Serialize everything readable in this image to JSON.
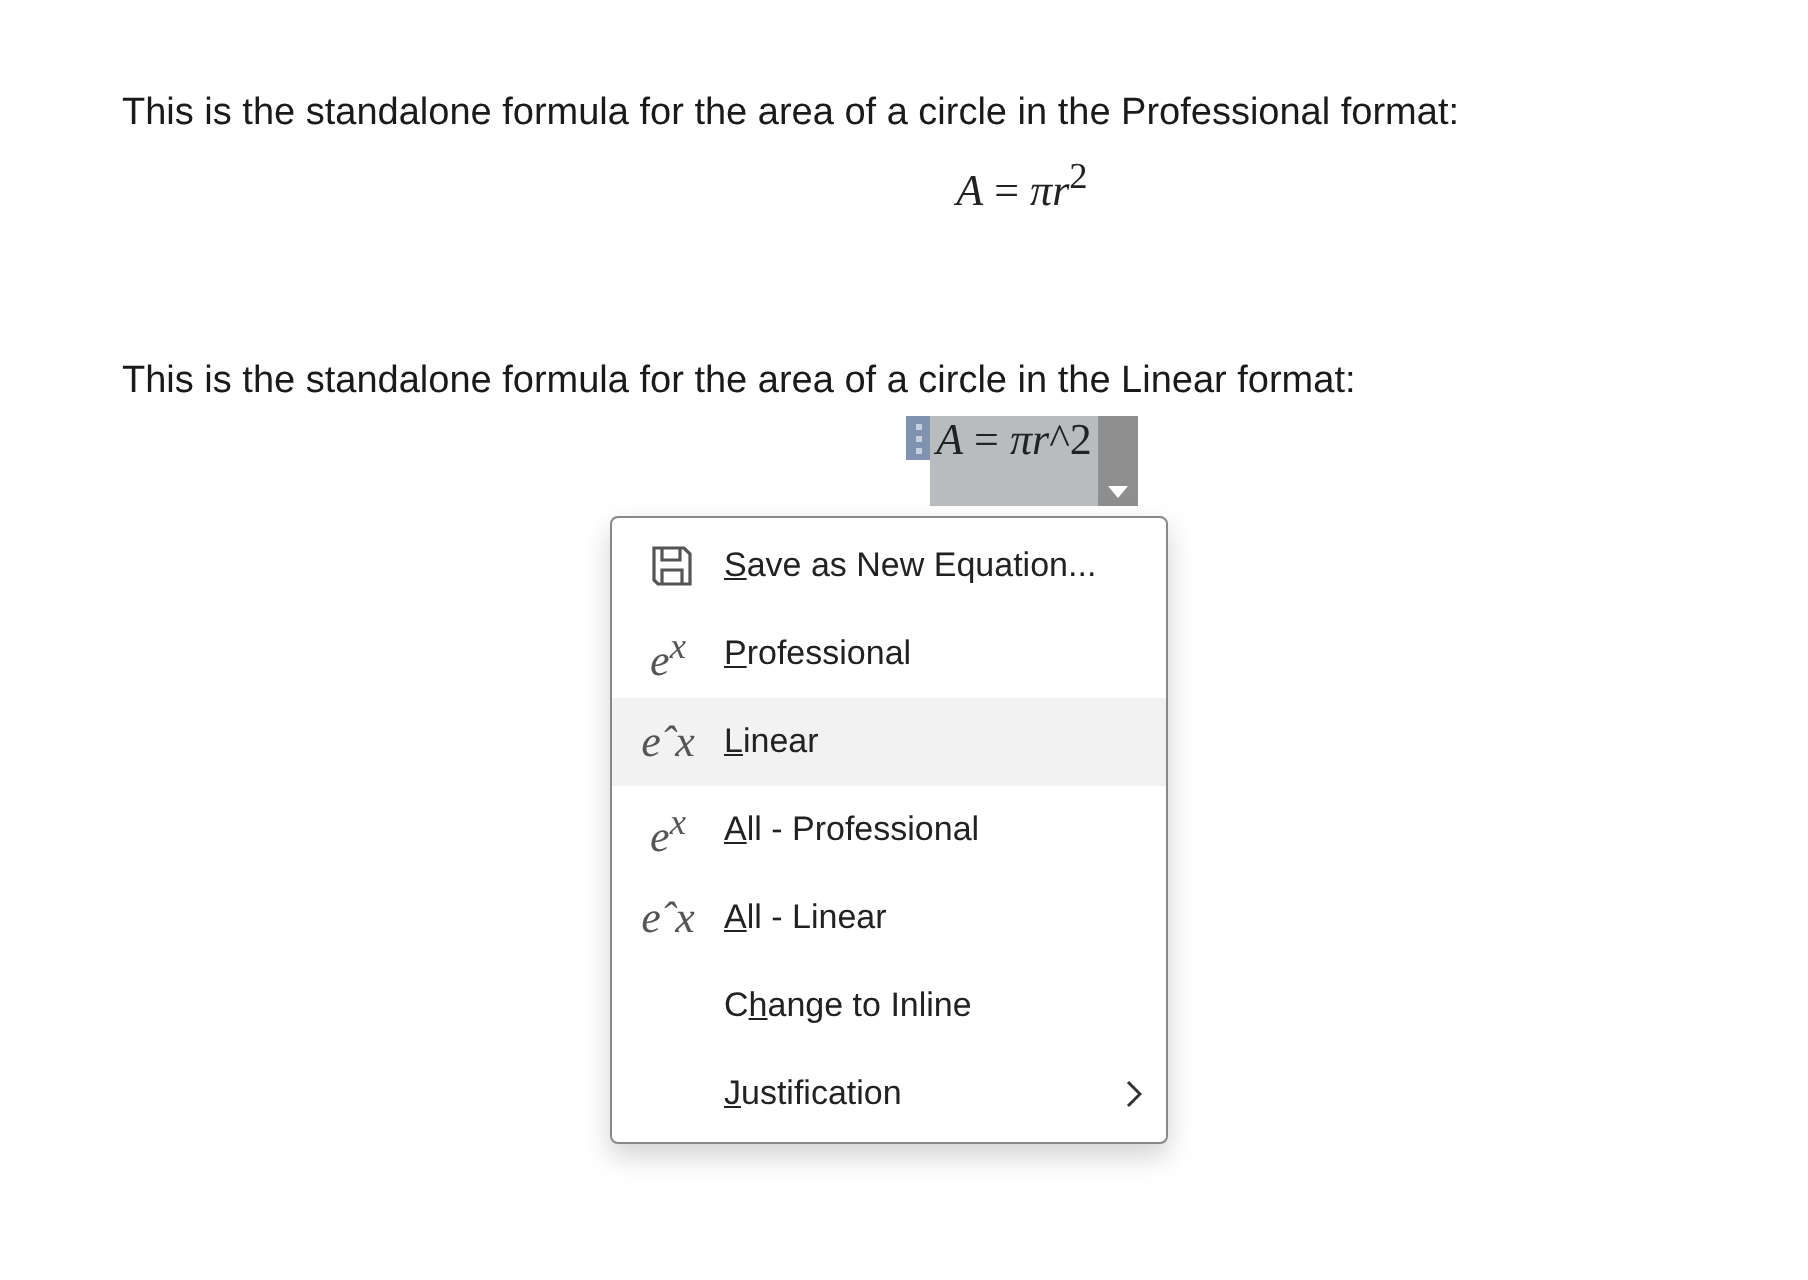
{
  "paragraphs": [
    {
      "text": "This is the standalone formula for the area of a circle in the Professional format:",
      "equation": {
        "text": "*A* = *πr*$^{2}$",
        "selected": false
      }
    },
    {
      "text": "This is the standalone formula for the area of a circle in the Linear format:",
      "equation": {
        "text": "*A* = *πr*^2",
        "selected": true
      }
    }
  ],
  "menu": {
    "items": [
      {
        "kind": "save",
        "key": "S",
        "post": "ave as New Equation...",
        "selected": false
      },
      {
        "kind": "format",
        "icon": "e$^{x}$",
        "key": "P",
        "post": "rofessional",
        "selected": false
      },
      {
        "kind": "format",
        "icon": "eˆx",
        "key": "L",
        "post": "inear",
        "selected": true
      },
      {
        "kind": "format",
        "icon": "e$^{x}$",
        "key": "A",
        "post": "ll - Professional",
        "selected": false
      },
      {
        "kind": "format",
        "icon": "eˆx",
        "key": "A",
        "post": "ll - Linear",
        "selected": false
      },
      {
        "kind": "plain",
        "pre": "C",
        "key": "h",
        "post": "ange to Inline",
        "selected": false
      },
      {
        "kind": "submenu",
        "key": "J",
        "post": "ustification",
        "selected": false
      }
    ]
  }
}
